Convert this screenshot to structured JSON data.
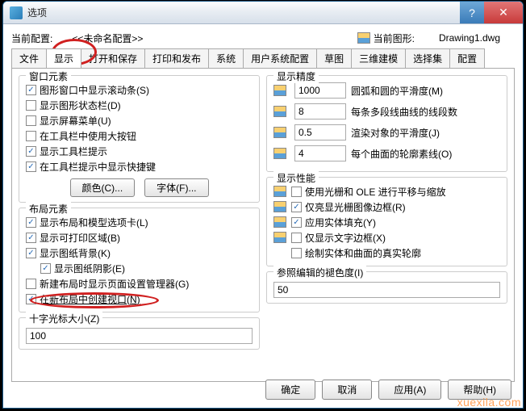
{
  "title": "选项",
  "config": {
    "current_label": "当前配置:",
    "current_value": "<<未命名配置>>",
    "drawing_label": "当前图形:",
    "drawing_value": "Drawing1.dwg"
  },
  "tabs": [
    "文件",
    "显示",
    "打开和保存",
    "打印和发布",
    "系统",
    "用户系统配置",
    "草图",
    "三维建模",
    "选择集",
    "配置"
  ],
  "window_el": {
    "title": "窗口元素",
    "c1": {
      "label": "图形窗口中显示滚动条(S)"
    },
    "c2": {
      "label": "显示图形状态栏(D)"
    },
    "c3": {
      "label": "显示屏幕菜单(U)"
    },
    "c4": {
      "label": "在工具栏中使用大按钮"
    },
    "c5": {
      "label": "显示工具栏提示"
    },
    "c6": {
      "label": "在工具栏提示中显示快捷键"
    },
    "btn_color": "颜色(C)...",
    "btn_font": "字体(F)..."
  },
  "layout_el": {
    "title": "布局元素",
    "c1": {
      "label": "显示布局和模型选项卡(L)"
    },
    "c2": {
      "label": "显示可打印区域(B)"
    },
    "c3": {
      "label": "显示图纸背景(K)"
    },
    "c4": {
      "label": "显示图纸阴影(E)"
    },
    "c5": {
      "label": "新建布局时显示页面设置管理器(G)"
    },
    "c6": {
      "label": "在新布局中创建视口(N)"
    }
  },
  "crosshair": {
    "title": "十字光标大小(Z)",
    "value": "100"
  },
  "precision": {
    "title": "显示精度",
    "r1": {
      "value": "1000",
      "label": "圆弧和圆的平滑度(M)"
    },
    "r2": {
      "value": "8",
      "label": "每条多段线曲线的线段数"
    },
    "r3": {
      "value": "0.5",
      "label": "渲染对象的平滑度(J)"
    },
    "r4": {
      "value": "4",
      "label": "每个曲面的轮廓素线(O)"
    }
  },
  "perf": {
    "title": "显示性能",
    "c1": {
      "label": "使用光栅和 OLE 进行平移与缩放"
    },
    "c2": {
      "label": "仅亮显光栅图像边框(R)"
    },
    "c3": {
      "label": "应用实体填充(Y)"
    },
    "c4": {
      "label": "仅显示文字边框(X)"
    },
    "c5": {
      "label": "绘制实体和曲面的真实轮廓"
    }
  },
  "ref_edit": {
    "title": "参照编辑的褪色度(I)",
    "value": "50"
  },
  "footer": {
    "ok": "确定",
    "cancel": "取消",
    "apply": "应用(A)",
    "help": "帮助(H)"
  },
  "watermark": "xuexila.com"
}
